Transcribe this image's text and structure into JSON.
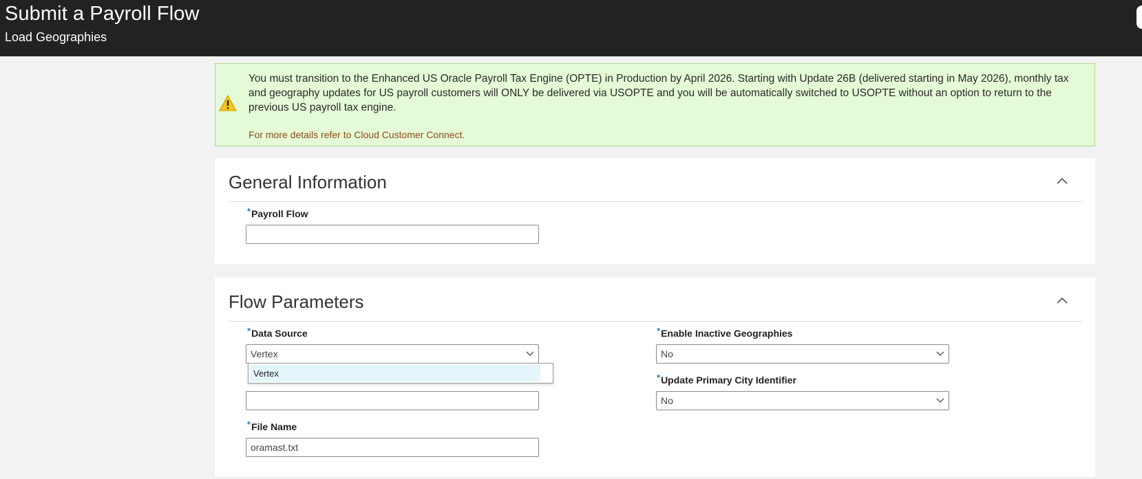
{
  "header": {
    "title": "Submit a Payroll Flow",
    "subtitle": "Load Geographies"
  },
  "banner": {
    "icon": "warning-icon",
    "message": "You must transition to the Enhanced US Oracle Payroll Tax Engine (OPTE) in Production by April 2026. Starting with Update 26B (delivered starting in May 2026), monthly tax and geography updates for US payroll customers will ONLY be delivered via USOPTE and you will be automatically switched to USOPTE without an option to return to the previous US payroll tax engine.",
    "link": "For more details refer to Cloud Customer Connect."
  },
  "general": {
    "title": "General Information",
    "payroll_flow": {
      "label": "Payroll Flow",
      "required_mark": "*",
      "value": ""
    }
  },
  "flow": {
    "title": "Flow Parameters",
    "data_source": {
      "label": "Data Source",
      "required_mark": "*",
      "value": "Vertex",
      "options": [
        "Vertex"
      ]
    },
    "hidden_field": {
      "value": ""
    },
    "file_name": {
      "label": "File Name",
      "required_mark": "*",
      "value": "oramast.txt"
    },
    "enable_inactive": {
      "label": "Enable Inactive Geographies",
      "required_mark": "*",
      "value": "No"
    },
    "update_primary_city": {
      "label": "Update Primary City Identifier",
      "required_mark": "*",
      "value": "No"
    }
  },
  "colors": {
    "header_bg": "#222222",
    "banner_bg": "#e5fad6",
    "banner_border": "#a8d98a",
    "required_mark": "#2b7bbd",
    "link": "#8a4b1a",
    "dropdown_highlight": "#e4f6fb"
  }
}
